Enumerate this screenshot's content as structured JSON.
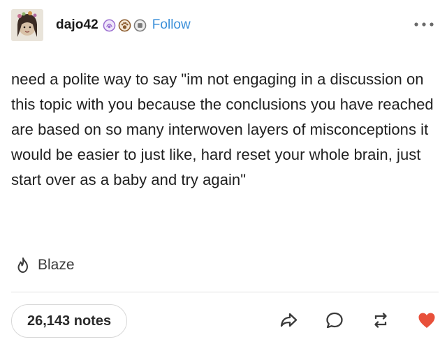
{
  "post": {
    "username": "dajo42",
    "follow_label": "Follow",
    "body": "need a polite way to say \"im not engaging in a discussion on this topic with you because the conclusions you have reached are based on so many interwoven layers of misconceptions it would be easier to just like, hard reset your whole brain, just start over as a baby and try again\"",
    "blaze_label": "Blaze",
    "notes_label": "26,143 notes"
  },
  "icons": {
    "more": "more-dots-icon",
    "blaze": "flame-icon",
    "share": "share-arrow-icon",
    "reply": "reply-bubble-icon",
    "reblog": "reblog-icon",
    "like": "heart-icon"
  },
  "colors": {
    "follow": "#3a8fd9",
    "like": "#e8503a",
    "badge_purple": "#9b6fd0",
    "badge_brown": "#8a5a2c",
    "badge_gray": "#7a7a7a"
  }
}
